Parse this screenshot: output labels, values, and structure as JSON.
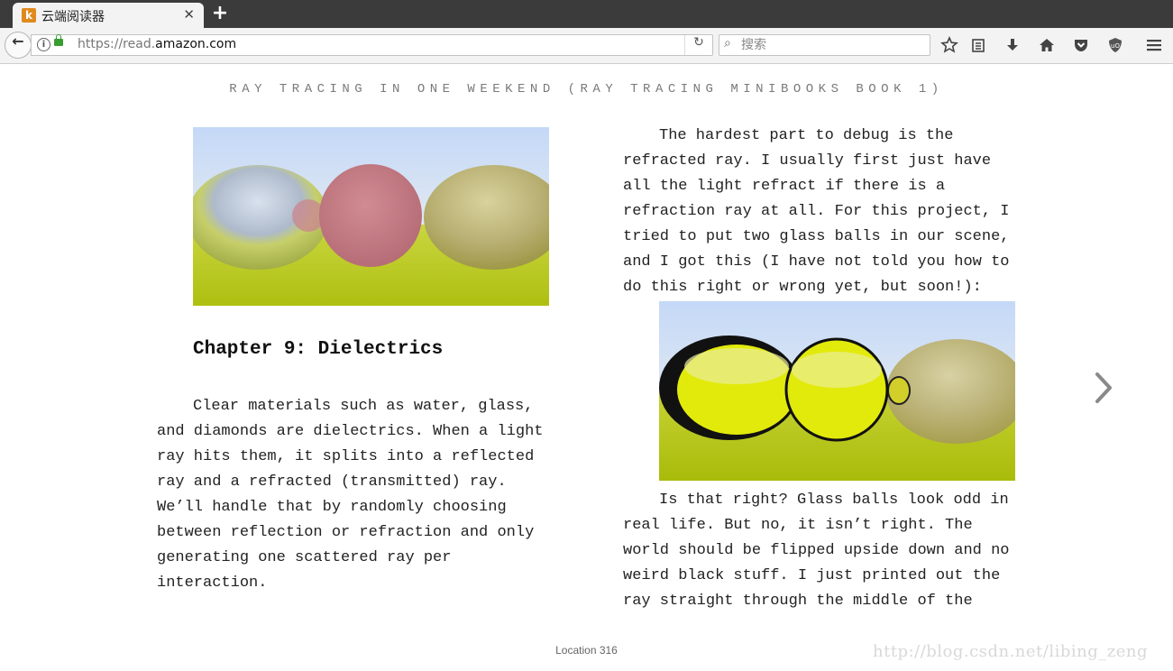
{
  "browser": {
    "tab": {
      "title": "云端阅读器",
      "favicon_letter": "k",
      "close_glyph": "✕"
    },
    "new_tab_glyph": "+",
    "back_glyph": "←",
    "address_bar": {
      "scheme_prefix": "https://read.",
      "host": "amazon.com"
    },
    "search_bar": {
      "placeholder": "搜索"
    },
    "toolbar_icons": [
      "bookmark-star-icon",
      "reading-list-icon",
      "download-icon",
      "home-icon",
      "pocket-icon",
      "ublock-icon",
      "menu-icon"
    ]
  },
  "reader": {
    "book_title": "RAY TRACING IN ONE WEEKEND (RAY TRACING MINIBOOKS BOOK 1)",
    "chapter_title": "Chapter 9:  Dielectrics",
    "left_paragraph": "Clear materials such as water, glass, and diamonds are dielectrics. When a light ray hits them, it splits into a reflected ray and a refracted (transmitted) ray. We’ll handle that by randomly choosing between reflection or refraction and only generating one scattered ray per interaction.",
    "right_paragraph_1": "The hardest part to debug is the refracted ray. I usually first just have all the light refract if there is a refraction ray at all. For this project, I tried to put two glass balls in our scene, and I got this (I have not told you how to do this right or wrong yet, but soon!):",
    "right_paragraph_2": "Is that right?  Glass balls look odd in real life. But no, it isn’t right. The world should be flipped upside down and no weird black stuff. I just printed out the ray straight through the middle of the",
    "location_label": "Location 316",
    "watermark": "http://blog.csdn.net/libing_zeng"
  },
  "colors": {
    "sky": "#c9ddf6",
    "ground": "#b4c716",
    "pink_sphere": "#c47b83",
    "glass_yellow": "#e3ec10"
  }
}
